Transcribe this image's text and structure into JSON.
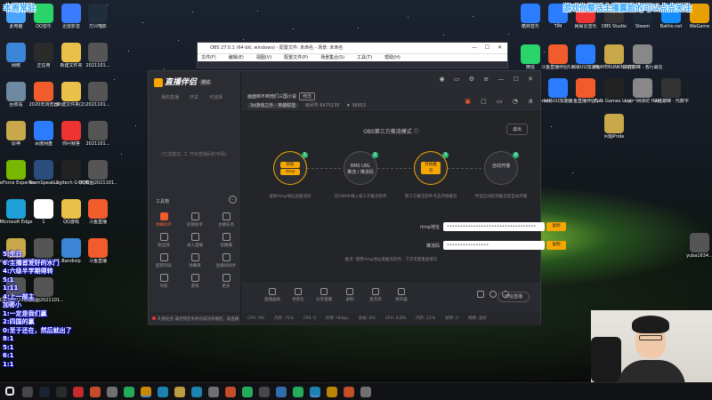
{
  "desktop": {
    "overlay_left": "本周常驻",
    "overlay_right": "游戏你整活主播露脸的可以点点关注",
    "chat_lines": [
      "5:生日",
      "6:主播首发好的水门",
      "4:六级半学期得转",
      "5:1",
      "1:11",
      "4:上一部主",
      "加密小",
      "1:一定是我们赢",
      "2:四国的赢",
      "0:至于还在，然后就出了",
      "8:1",
      "5:1",
      "6:1",
      "1:1"
    ],
    "icons_left": [
      {
        "label": "此电脑",
        "color": "#4aa3ff"
      },
      {
        "label": "QQ音乐",
        "color": "#2bd36b"
      },
      {
        "label": "迅雷影音",
        "color": "#3b7cff"
      },
      {
        "label": "万兴喵影",
        "color": "#1f2d3d"
      },
      {
        "label": "网络",
        "color": "#3b86d6"
      },
      {
        "label": "正在用",
        "color": "#2b2b2b"
      },
      {
        "label": "新建文件夹",
        "color": "#e8c04a"
      },
      {
        "label": "2021101...",
        "color": "#555"
      },
      {
        "label": "回收站",
        "color": "#6f8aa0"
      },
      {
        "label": "2020年浏览器",
        "color": "#f25c2c"
      },
      {
        "label": "新建文件夹(2)",
        "color": "#e8c04a"
      },
      {
        "label": "2021101...",
        "color": "#555"
      },
      {
        "label": "原神",
        "color": "#c9a84a"
      },
      {
        "label": "百度网盘",
        "color": "#2b7cff"
      },
      {
        "label": "你问我答",
        "color": "#e33"
      },
      {
        "label": "2021101...",
        "color": "#555"
      },
      {
        "label": "GeForce Experience",
        "color": "#76b900"
      },
      {
        "label": "TeamSpeak 3",
        "color": "#2b4d7c"
      },
      {
        "label": "Logitech G HUB",
        "color": "#222"
      },
      {
        "label": "QQ截图2021101...",
        "color": "#555"
      },
      {
        "label": "Microsoft Edge",
        "color": "#1fa0d8"
      },
      {
        "label": "1",
        "color": "#fff"
      },
      {
        "label": "QQ游戏",
        "color": "#e8c04a"
      },
      {
        "label": "斗鱼直播",
        "color": "#f25c2c"
      },
      {
        "label": "League of Legends",
        "color": "#c9a84a"
      },
      {
        "label": "QQ截图2021101...",
        "color": "#555"
      },
      {
        "label": "Bandizip",
        "color": "#3b86d6"
      },
      {
        "label": "斗鱼直播",
        "color": "#f25c2c"
      },
      {
        "label": "QQ截图2021101...",
        "color": "#555"
      },
      {
        "label": "QQ截图2021101...",
        "color": "#555"
      }
    ],
    "icons_right": [
      {
        "label": "酷狗音乐",
        "color": "#2b7cff"
      },
      {
        "label": "TIM",
        "color": "#2b7cff"
      },
      {
        "label": "网易云音乐",
        "color": "#e33"
      },
      {
        "label": "OBS Studio",
        "color": "#333"
      },
      {
        "label": "Steam",
        "color": "#1b2838"
      },
      {
        "label": "Battle.net",
        "color": "#148eff"
      },
      {
        "label": "WeGame",
        "color": "#e8a000"
      },
      {
        "label": "微信",
        "color": "#2bd36b"
      },
      {
        "label": "斗鱼直播伴侣5.0",
        "color": "#f25c2c"
      },
      {
        "label": "网易UU加速器",
        "color": "#2b7cff"
      },
      {
        "label": "PLAYERUNKNOWN BATTLEGR...",
        "color": "#c9a84a"
      },
      {
        "label": "决胜巅峰 · 各行最在网",
        "color": "#888"
      },
      {
        "label": "英雄联盟WeGame版",
        "color": "#c9a84a"
      },
      {
        "label": "网易UU加速器",
        "color": "#2b7cff"
      },
      {
        "label": "斗鱼直播伴侣5.0",
        "color": "#f25c2c"
      },
      {
        "label": "Epic Games Launcher",
        "color": "#222"
      },
      {
        "label": "人民一网球坊 Human Fa...",
        "color": "#888"
      },
      {
        "label": "决胜巅峰 · 代数字",
        "color": "#333"
      },
      {
        "label": "问题Pride",
        "color": "#c9a84a"
      },
      {
        "label": "yuba1634...",
        "color": "#555"
      }
    ]
  },
  "obs": {
    "title": "OBS 27.0.1 (64-bit, windows) - 配置文件: 未命名 - 场景: 未命名",
    "menu": [
      "文件(F)",
      "编辑(E)",
      "视图(V)",
      "配置文件(P)",
      "场景集合(S)",
      "工具(T)",
      "帮助(H)"
    ]
  },
  "app": {
    "logo": "直播伴侣",
    "logo_tag": "测试",
    "side_tabs": [
      "我的直播",
      "开关",
      "可选择"
    ],
    "sidebar_empty": "(已选模式: 工 开启直播间的字码)",
    "tools_title": "工具箱",
    "tools": [
      {
        "label": "弹幕助手",
        "active": true
      },
      {
        "label": "房管助手",
        "active": false
      },
      {
        "label": "主播任务",
        "active": false
      },
      {
        "label": "粉丝牌",
        "active": false
      },
      {
        "label": "录入直播",
        "active": false
      },
      {
        "label": "读播播",
        "active": false
      },
      {
        "label": "超管列表",
        "active": false
      },
      {
        "label": "弹幕库",
        "active": false
      },
      {
        "label": "直播间助手",
        "active": false
      },
      {
        "label": "导航",
        "active": false
      },
      {
        "label": "游戏",
        "active": false
      },
      {
        "label": "更多",
        "active": false
      }
    ],
    "sidebar_bottom": "礼物任务  满足特定条件的成功开播后，就直播",
    "room_title": "画面到不到他们三国小说",
    "room_badge": "修改",
    "room_meta": {
      "category": "3d游戏之外 · 英雄联盟",
      "room": "房间号 6475135",
      "fans": "36653"
    },
    "panel_title": "OBS第三方推流模式",
    "exit_label": "退出",
    "steps": [
      {
        "num": "1",
        "lines": [
          "获取",
          "rtmp"
        ],
        "pills": true,
        "on": true,
        "desc": "复制rtmp地址及推流码"
      },
      {
        "num": "2",
        "lines": [
          "RMS URL",
          "推流 / 推流码"
        ],
        "pills": false,
        "on": false,
        "desc": "在OBS中填入第三方推流软件"
      },
      {
        "num": "3",
        "lines": [
          "开始推流"
        ],
        "pills": true,
        "on": true,
        "desc": "第三方推流软件点击开始推流"
      },
      {
        "num": "4",
        "lines": [
          "自动开播"
        ],
        "pills": false,
        "on": false,
        "desc": "伴侣自动检测推流后自动开播"
      }
    ],
    "rtmp_label": "rtmp地址",
    "rtmp_value": "••••••••••••••••••••••••••••••••••",
    "key_label": "推流码",
    "key_value": "••••••••••••••••",
    "copy_label": "复制",
    "hint": "推流: 使用rtmp地址发推流软件，下次无需重复填写",
    "bottom_tools": [
      "直播画质",
      "场景化",
      "分享直播",
      "录制",
      "麦克风",
      "扬声器"
    ],
    "start_label": "开始直播",
    "status": [
      "CPU: 9%",
      "内存: 71%",
      "FPS: 0",
      "码率: 0kbps",
      "丢帧: 0%",
      "CPU: 8.8%",
      "内存: 21%",
      "帧率: 0",
      "网络: 良好"
    ]
  }
}
